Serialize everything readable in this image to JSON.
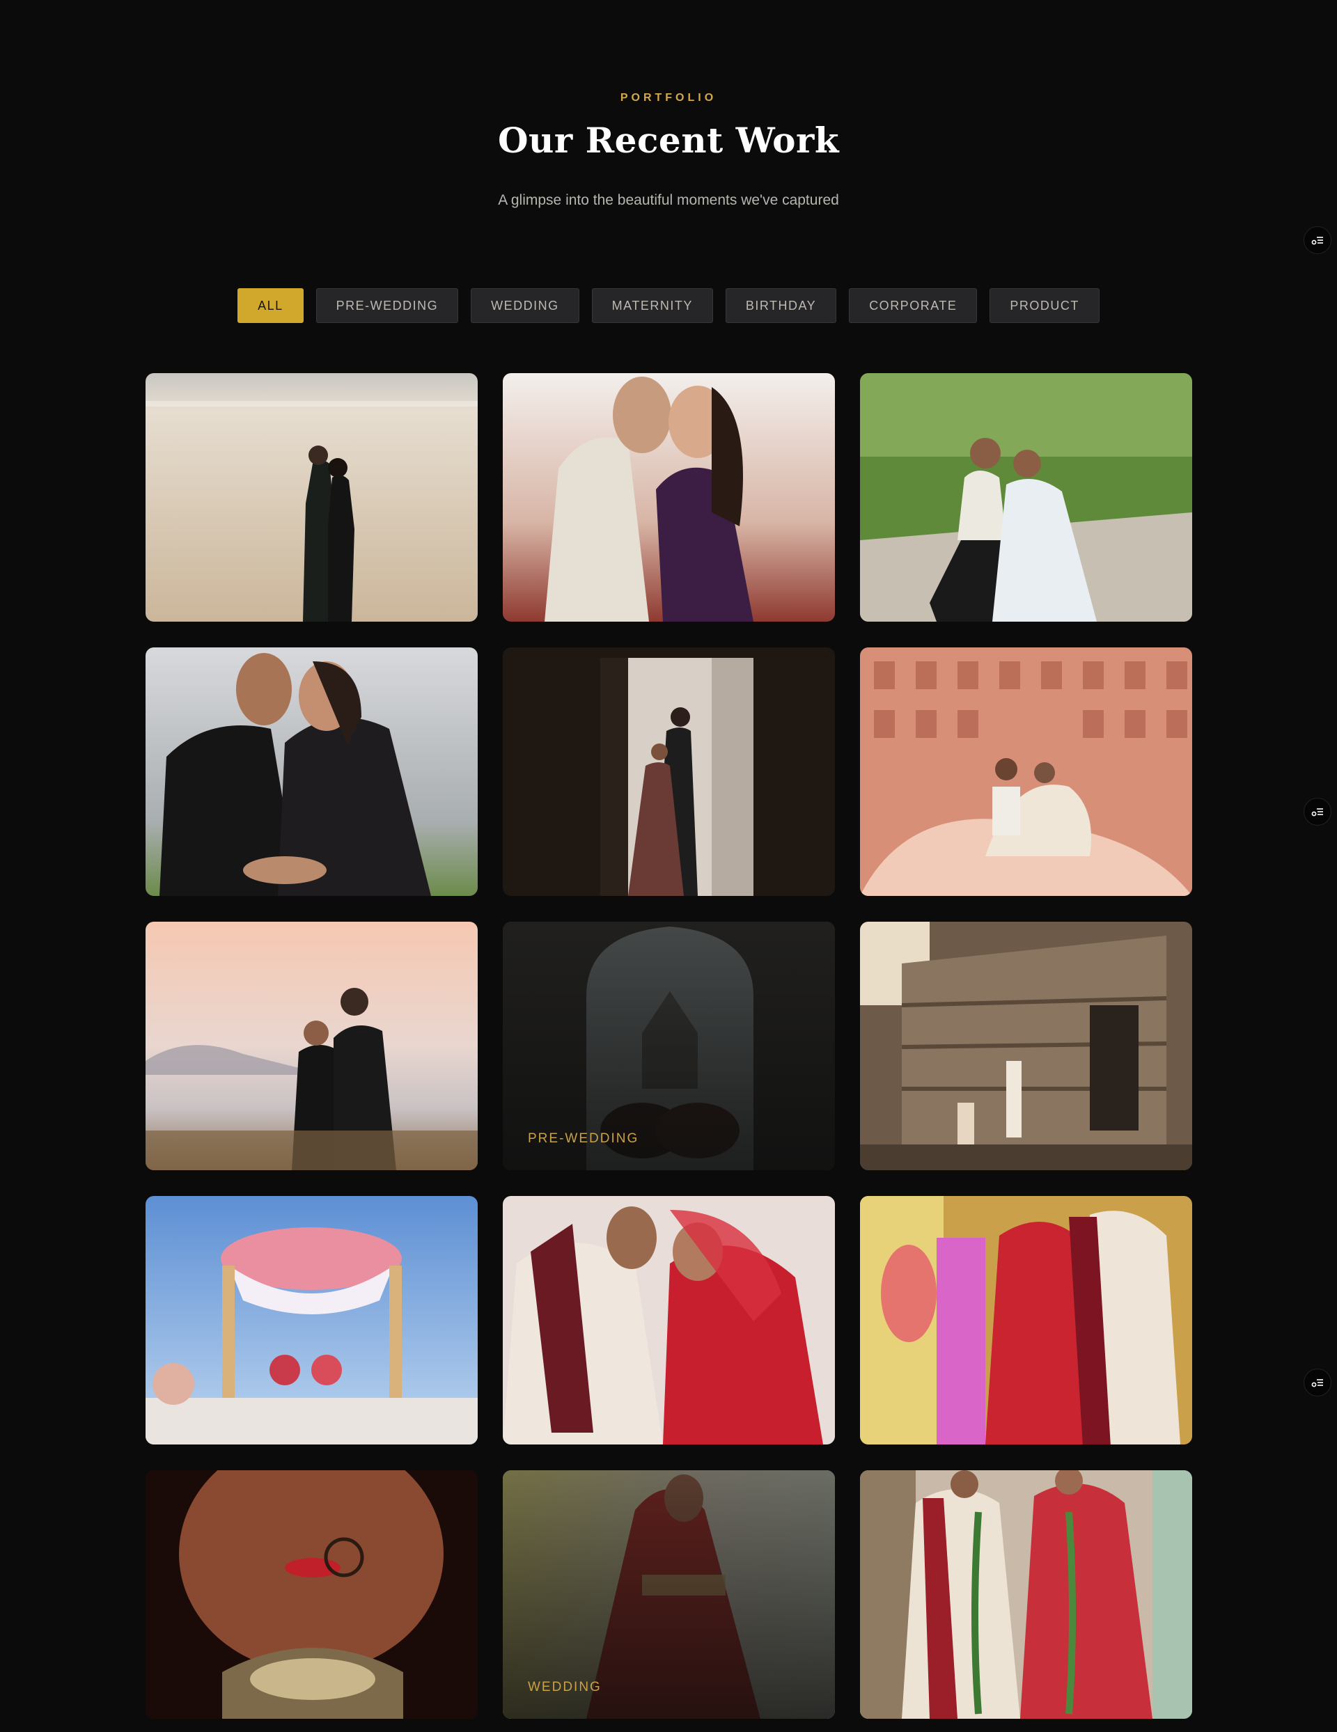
{
  "section": {
    "eyebrow": "PORTFOLIO",
    "title": "Our Recent Work",
    "subtitle": "A glimpse into the beautiful moments we've captured"
  },
  "filters": [
    {
      "label": "ALL",
      "active": true
    },
    {
      "label": "PRE-WEDDING",
      "active": false
    },
    {
      "label": "WEDDING",
      "active": false
    },
    {
      "label": "MATERNITY",
      "active": false
    },
    {
      "label": "BIRTHDAY",
      "active": false
    },
    {
      "label": "CORPORATE",
      "active": false
    },
    {
      "label": "PRODUCT",
      "active": false
    }
  ],
  "gallery": [
    {
      "icon": "couple-beach-photo"
    },
    {
      "icon": "couple-forehead-touch-photo"
    },
    {
      "icon": "couple-seated-grass-photo"
    },
    {
      "icon": "couple-black-outfits-photo"
    },
    {
      "icon": "couple-doorway-photo"
    },
    {
      "icon": "couple-hawa-mahal-photo"
    },
    {
      "icon": "couple-lake-sunset-photo"
    },
    {
      "icon": "couple-temple-arch-photo",
      "category": "PRE-WEDDING"
    },
    {
      "icon": "couple-stone-temple-photo"
    },
    {
      "icon": "wedding-mandap-photo"
    },
    {
      "icon": "bride-groom-embrace-photo"
    },
    {
      "icon": "bride-groom-ritual-photo"
    },
    {
      "icon": "bride-closeup-photo"
    },
    {
      "icon": "bride-red-lehenga-photo",
      "category": "WEDDING"
    },
    {
      "icon": "bride-groom-garlands-photo"
    }
  ],
  "colors": {
    "background": "#0b0b0c",
    "accent": "#d1a72c",
    "eyebrow": "#d4a94a"
  },
  "side_buttons": [
    {
      "icon": "settings-list-icon"
    },
    {
      "icon": "settings-list-icon"
    },
    {
      "icon": "settings-list-icon"
    }
  ]
}
